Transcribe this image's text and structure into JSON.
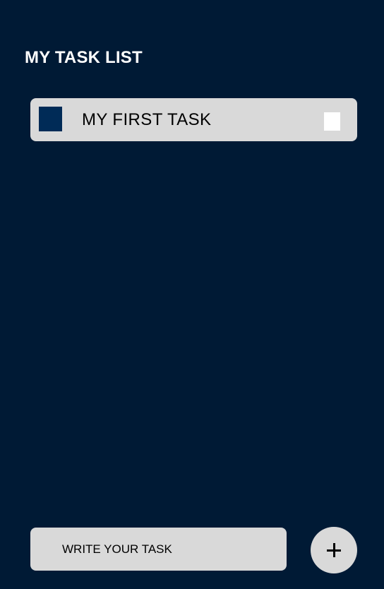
{
  "header": {
    "title": "MY TASK LIST"
  },
  "tasks": [
    {
      "label": "MY FIRST TASK"
    }
  ],
  "composer": {
    "placeholder": "WRITE YOUR TASK",
    "value": ""
  },
  "add_button": {
    "icon": "plus-icon"
  },
  "colors": {
    "background": "#001a35",
    "card": "#d9d9d9",
    "task_marker": "#002b57",
    "checkbox": "#ffffff",
    "text_light": "#ffffff",
    "text_dark": "#000000"
  }
}
